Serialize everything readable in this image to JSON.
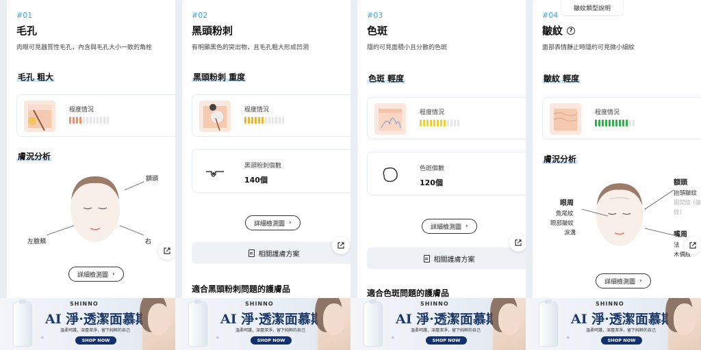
{
  "tooltip": "皺紋類型說明",
  "panels": [
    {
      "num": "#01",
      "title": "毛孔",
      "desc": "肉眼可見器質性毛孔，內含與毛孔大小一致的角栓",
      "level_title": "毛孔 粗大",
      "level_label": "程度情況",
      "level_color": "#f0906a",
      "level_filled": 4,
      "level_total": 12,
      "analysis_title": "膚況分析",
      "face_labels": [
        "額頭",
        "左臉頰",
        "右"
      ],
      "detail_button": "詳細檢測圖"
    },
    {
      "num": "#02",
      "title": "黑頭粉刺",
      "desc": "有明顯黑色的突出物，且毛孔粗大形成凹洞",
      "level_title": "黑頭粉刺 重度",
      "level_label": "程度情況",
      "level_color": "#f0b429",
      "level_filled": 6,
      "level_total": 12,
      "count_label": "黑頭粉刺個數",
      "count_value": "140個",
      "detail_button": "詳細檢測圖",
      "plan_button": "相關護膚方案",
      "products_title": "適合黑頭粉刺問題的護膚品"
    },
    {
      "num": "#03",
      "title": "色斑",
      "desc": "隱約可見面積小且分散的色斑",
      "level_title": "色斑 輕度",
      "level_label": "程度情況",
      "level_color": "#f2d12a",
      "level_filled": 8,
      "level_total": 12,
      "count_label": "色斑個數",
      "count_value": "120個",
      "detail_button": "詳細檢測圖",
      "plan_button": "相關護膚方案",
      "products_title": "適合色斑問題的護膚品"
    },
    {
      "num": "#04",
      "title": "皺紋",
      "desc": "面部表情靜止時隱約可見微小細紋",
      "level_title": "皺紋 輕度",
      "level_label": "程度情況",
      "level_color": "#2bb34a",
      "level_filled": 10,
      "level_total": 12,
      "analysis_title": "膚況分析",
      "eyes_label": "眼周",
      "eyes_items": [
        "魚尾紋",
        "眼部皺紋",
        "淚溝"
      ],
      "forehead_label": "額頭",
      "forehead_items": [
        "抬頭皺紋",
        "眉間紋 (皺",
        "紋)"
      ],
      "mouth_label": "嘴周",
      "mouth_items": [
        "法",
        "木偶紋"
      ],
      "detail_button": "詳細檢測圖"
    }
  ],
  "ad": {
    "brand": "SHINNO",
    "title": "AI 淨·透潔面慕斯",
    "subtitle": "溫柔呵護．深層潔淨，留下純粹的自己",
    "button": "SHOP NOW"
  }
}
